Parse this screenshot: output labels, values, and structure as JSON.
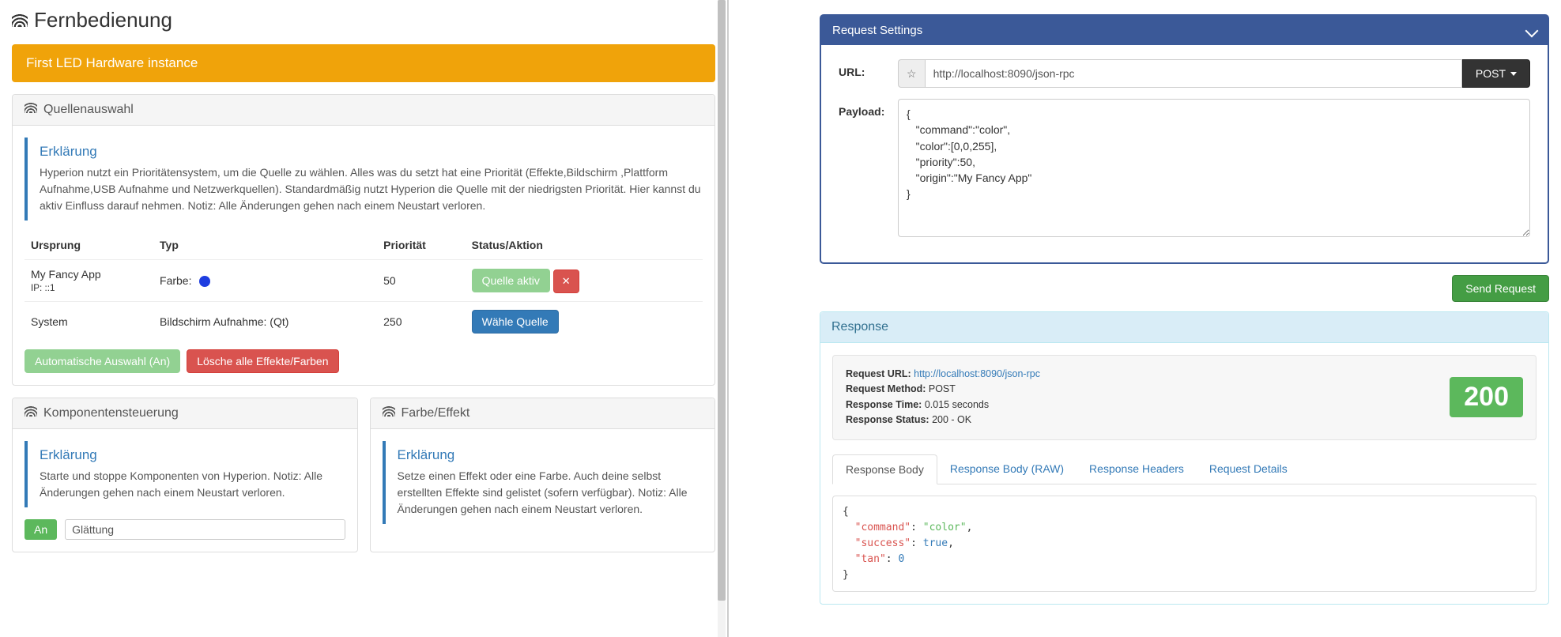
{
  "left": {
    "title": "Fernbedienung",
    "banner": "First LED Hardware instance",
    "source_panel": {
      "heading": "Quellenauswahl",
      "explain_title": "Erklärung",
      "explain_body": "Hyperion nutzt ein Prioritätensystem, um die Quelle zu wählen. Alles was du setzt hat eine Priorität (Effekte,Bildschirm ,Plattform Aufnahme,USB Aufnahme und Netzwerkquellen). Standardmäßig nutzt Hyperion die Quelle mit der niedrigsten Priorität. Hier kannst du aktiv Einfluss darauf nehmen. Notiz: Alle Änderungen gehen nach einem Neustart verloren.",
      "columns": {
        "origin": "Ursprung",
        "type": "Typ",
        "priority": "Priorität",
        "status": "Status/Aktion"
      },
      "rows": [
        {
          "origin": "My Fancy App",
          "origin_sub": "IP: ::1",
          "type": "Farbe:",
          "color": "#1e3de0",
          "priority": "50",
          "status_btn": "Quelle aktiv",
          "close": "✕"
        },
        {
          "origin": "System",
          "origin_sub": "",
          "type": "Bildschirm Aufnahme: (Qt)",
          "color": "",
          "priority": "250",
          "status_btn": "Wähle Quelle",
          "close": ""
        }
      ],
      "auto_btn": "Automatische Auswahl (An)",
      "clear_btn": "Lösche alle Effekte/Farben"
    },
    "components_panel": {
      "heading": "Komponentensteuerung",
      "explain_title": "Erklärung",
      "explain_body": "Starte und stoppe Komponenten von Hyperion. Notiz: Alle Änderungen gehen nach einem Neustart verloren.",
      "toggle_on": "An",
      "toggle_label": "Glättung"
    },
    "coloreffect_panel": {
      "heading": "Farbe/Effekt",
      "explain_title": "Erklärung",
      "explain_body": "Setze einen Effekt oder eine Farbe. Auch deine selbst erstellten Effekte sind gelistet (sofern verfügbar). Notiz: Alle Änderungen gehen nach einem Neustart verloren."
    }
  },
  "right": {
    "request": {
      "heading": "Request Settings",
      "url_label": "URL:",
      "url_value": "http://localhost:8090/json-rpc",
      "method": "POST",
      "payload_label": "Payload:",
      "payload_value": "{\n   \"command\":\"color\",\n   \"color\":[0,0,255],\n   \"priority\":50,\n   \"origin\":\"My Fancy App\"\n}",
      "send_btn": "Send Request"
    },
    "response": {
      "heading": "Response",
      "meta": {
        "url_label": "Request URL:",
        "url_value": "http://localhost:8090/json-rpc",
        "method_label": "Request Method:",
        "method_value": "POST",
        "time_label": "Response Time:",
        "time_value": "0.015 seconds",
        "status_label": "Response Status:",
        "status_value": "200 - OK"
      },
      "status_code": "200",
      "tabs": [
        "Response Body",
        "Response Body (RAW)",
        "Response Headers",
        "Request Details"
      ],
      "body_tokens": {
        "k1": "\"command\"",
        "v1": "\"color\"",
        "k2": "\"success\"",
        "v2": "true",
        "k3": "\"tan\"",
        "v3": "0"
      }
    }
  }
}
